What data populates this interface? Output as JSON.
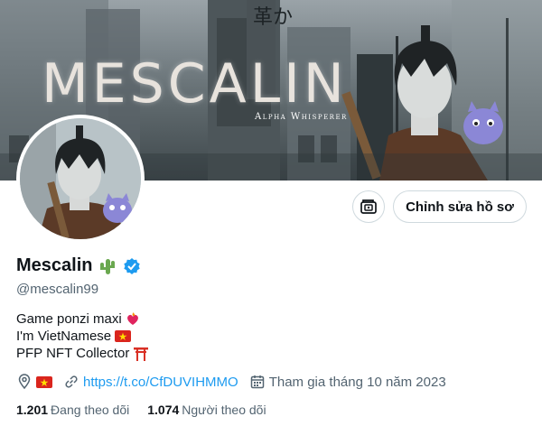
{
  "banner": {
    "title": "MESCALIN",
    "subtitle": "Alpha Whisperer",
    "kanji": "革か"
  },
  "actions": {
    "icon_button": "wallet-icon",
    "edit_profile_label": "Chỉnh sửa hồ sơ"
  },
  "profile": {
    "display_name": "Mescalin",
    "name_emoji": "cactus",
    "verified": true,
    "handle": "@mescalin99",
    "bio": [
      {
        "text": "Game ponzi maxi",
        "emoji": "heart-on-fire"
      },
      {
        "text": "I'm VietNamese",
        "emoji": "vietnam-flag"
      },
      {
        "text": "PFP NFT Collector",
        "emoji": "torii-gate"
      }
    ],
    "location_emoji": "vietnam-flag",
    "link": "https://t.co/CfDUVIHMMO",
    "joined": "Tham gia tháng 10 năm 2023"
  },
  "stats": {
    "following_count": "1.201",
    "following_label": "Đang theo dõi",
    "followers_count": "1.074",
    "followers_label": "Người theo dõi"
  },
  "colors": {
    "accent": "#1d9bf0",
    "text": "#0f1419",
    "secondary": "#536471",
    "border": "#cfd9de"
  }
}
